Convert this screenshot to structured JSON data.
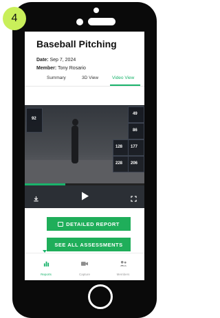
{
  "step_number": "4",
  "page": {
    "title": "Baseball Pitching",
    "date_label": "Date:",
    "date_value": "Sep 7, 2024",
    "member_label": "Member:",
    "member_value": "Tony Rosario"
  },
  "tabs": [
    {
      "label": "Summary",
      "active": false
    },
    {
      "label": "3D View",
      "active": false
    },
    {
      "label": "Video View",
      "active": true
    }
  ],
  "video": {
    "panel_values": [
      "92",
      "49",
      "86",
      "128",
      "177",
      "228",
      "206"
    ],
    "progress": 0.34,
    "controls": {
      "download_icon": "download-icon",
      "play_icon": "play-icon",
      "fullscreen_icon": "fullscreen-icon"
    }
  },
  "buttons": {
    "detailed_report": "DETAILED REPORT",
    "see_all_assessments": "SEE ALL ASSESSMENTS"
  },
  "bottom_nav": [
    {
      "label": "Reports",
      "icon": "bar-chart-icon",
      "active": true
    },
    {
      "label": "Capture",
      "icon": "camera-icon",
      "active": false
    },
    {
      "label": "Members",
      "icon": "members-icon",
      "active": false
    }
  ],
  "colors": {
    "accent_green": "#1fae5a",
    "badge_lime": "#c9ef5a",
    "phone_body": "#0a0a0a"
  }
}
